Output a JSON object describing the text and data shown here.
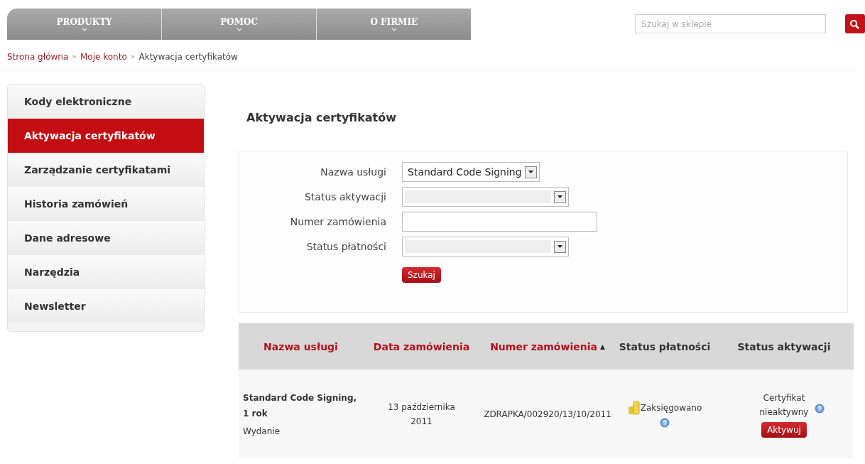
{
  "nav": {
    "items": [
      {
        "label": "PRODUKTY"
      },
      {
        "label": "POMOC"
      },
      {
        "label": "O FIRMIE"
      }
    ]
  },
  "search": {
    "placeholder": "Szukaj w sklepie"
  },
  "breadcrumb": [
    {
      "label": "Strona główna",
      "kind": "link"
    },
    {
      "label": "»",
      "kind": "separator"
    },
    {
      "label": "Moje konto",
      "kind": "link"
    },
    {
      "label": "»",
      "kind": "separator"
    },
    {
      "label": "Aktywacja certyfikatów",
      "kind": "current"
    }
  ],
  "sidebar": {
    "items": [
      {
        "label": "Kody elektroniczne",
        "selected": false
      },
      {
        "label": "Aktywacja certyfikatów",
        "selected": true
      },
      {
        "label": "Zarządzanie certyfikatami",
        "selected": false
      },
      {
        "label": "Historia zamówień",
        "selected": false
      },
      {
        "label": "Dane adresowe",
        "selected": false
      },
      {
        "label": "Narzędzia",
        "selected": false
      },
      {
        "label": "Newsletter",
        "selected": false
      }
    ]
  },
  "page_title": "Aktywacja certyfikatów",
  "filters": {
    "fields": [
      {
        "label": "Nazwa usługi",
        "kind": "select",
        "value": "Standard Code Signing"
      },
      {
        "label": "Status aktywacji",
        "kind": "select"
      },
      {
        "label": "Numer zamówienia",
        "kind": "text"
      },
      {
        "label": "Status płatności",
        "kind": "select"
      }
    ],
    "button": "Szukaj"
  },
  "table": {
    "columns": [
      {
        "label": "Nazwa usługi",
        "kind": "link"
      },
      {
        "label": "Data zamówienia",
        "kind": "link"
      },
      {
        "label": "Numer zamówienia",
        "kind": "link",
        "sort_mark": "▲"
      },
      {
        "label": "Status płatności",
        "kind": "plain"
      },
      {
        "label": "Status aktywacji",
        "kind": "plain"
      }
    ],
    "rows": [
      {
        "service": "Standard Code Signing, 1 rok",
        "service_note": "Wydanie",
        "date": "13 października 2011",
        "number": "ZDRAPKA/002920/13/10/2011",
        "payment": "Zaksięgowano",
        "activation": "Certyfikat nieaktywny",
        "action": "Aktywuj"
      }
    ]
  }
}
